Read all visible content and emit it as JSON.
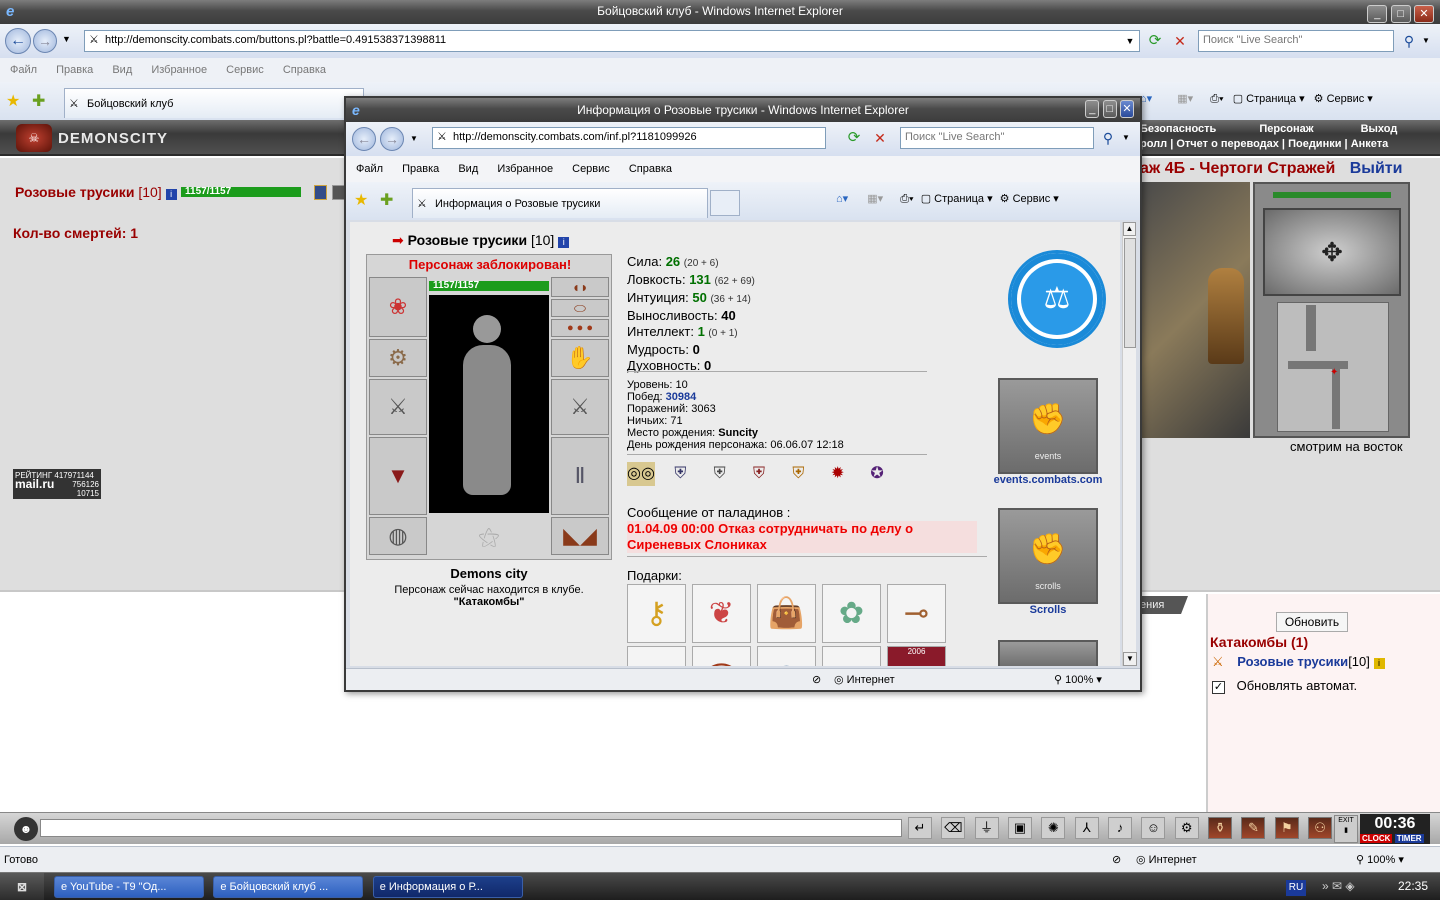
{
  "main_window": {
    "title": "Бойцовский клуб - Windows Internet Explorer",
    "url": "http://demonscity.combats.com/buttons.pl?battle=0.491538371398811",
    "search_placeholder": "Поиск \"Live Search\"",
    "menu": [
      "Файл",
      "Правка",
      "Вид",
      "Избранное",
      "Сервис",
      "Справка"
    ],
    "tab_label": "Бойцовский клуб",
    "toolbar_page": "Страница",
    "toolbar_service": "Сервис",
    "status_text": "Готово",
    "zone": "Интернет",
    "zoom": "100%"
  },
  "game": {
    "logo": "DEMONSCITY",
    "nav_row1": [
      "Безопасность",
      "Персонаж",
      "Выход"
    ],
    "nav_row2": [
      "ролл",
      "Отчет о переводах",
      "Поединки",
      "Анкета"
    ],
    "location_title": "аж 4Б - Чертоги Стражей",
    "exit_link": "Выйти",
    "player_name": "Розовые трусики",
    "player_level": "[10]",
    "hp_text": "1157/1157",
    "deaths_text": "Кол-во смертей: 1",
    "direction_text": "смотрим на восток",
    "counter_rating": "РЕЙТИНГ 417971144",
    "counter_logo": "mail.ru",
    "counter_v1": "756126",
    "counter_v2": "10715",
    "peek_tab": "ения",
    "refresh_button": "Обновить",
    "room_title": "Катакомбы (1)",
    "room_player_name": "Розовые трусики",
    "room_player_level": "[10]",
    "autorefresh_label": "Обновлять автомат.",
    "clock": "00:36",
    "clock_label": "CLOCK",
    "timer_label": "TIMER",
    "exit_tiny": "EXIT"
  },
  "popup": {
    "title": "Информация о Розовые трусики - Windows Internet Explorer",
    "url": "http://demonscity.combats.com/inf.pl?1181099926",
    "search_placeholder": "Поиск \"Live Search\"",
    "menu": [
      "Файл",
      "Правка",
      "Вид",
      "Избранное",
      "Сервис",
      "Справка"
    ],
    "tab_label": "Информация о Розовые трусики",
    "toolbar_page": "Страница",
    "toolbar_service": "Сервис",
    "zone": "Интернет",
    "zoom": "100%",
    "char_name": "Розовые трусики",
    "char_level": "[10]",
    "blocked": "Персонаж заблокирован!",
    "hp_text": "1157/1157",
    "city": "Demons city",
    "location_line": "Персонаж сейчас находится в клубе.",
    "location_name": "\"Катакомбы\"",
    "stats": [
      {
        "label": "Сила:",
        "value": "26",
        "extra": "(20 + 6)",
        "color": "green"
      },
      {
        "label": "Ловкость:",
        "value": "131",
        "extra": "(62 + 69)",
        "color": "green"
      },
      {
        "label": "Интуиция:",
        "value": "50",
        "extra": "(36 + 14)",
        "color": "green"
      },
      {
        "label": "Выносливость:",
        "value": "40",
        "extra": "",
        "color": "black"
      },
      {
        "label": "Интеллект:",
        "value": "1",
        "extra": "(0 + 1)",
        "color": "green"
      },
      {
        "label": "Мудрость:",
        "value": "0",
        "extra": "",
        "color": "black"
      },
      {
        "label": "Духовность:",
        "value": "0",
        "extra": "",
        "color": "black"
      }
    ],
    "info": {
      "level_label": "Уровень:",
      "level": "10",
      "wins_label": "Побед:",
      "wins": "30984",
      "losses_label": "Поражений:",
      "losses": "3063",
      "draws_label": "Ничьих:",
      "draws": "71",
      "birthplace_label": "Место рождения:",
      "birthplace": "Suncity",
      "birthday_label": "День рождения персонажа:",
      "birthday": "06.06.07 12:18"
    },
    "paladin_header": "Сообщение от паладинов :",
    "paladin_message": "01.04.09 00:00 Отказ сотрудничать по делу о Сиреневых Слониках",
    "gifts_label": "Подарки:",
    "gift_year": "2006",
    "banner_events_text": "events",
    "banner_events_link": "events.combats.com",
    "banner_scrolls_text": "scrolls",
    "banner_scrolls_link": "Scrolls"
  },
  "taskbar": {
    "tasks": [
      "YouTube - T9 \"Од...",
      "Бойцовский клуб ...",
      "Информация о Р..."
    ],
    "lang": "RU",
    "time": "22:35"
  }
}
